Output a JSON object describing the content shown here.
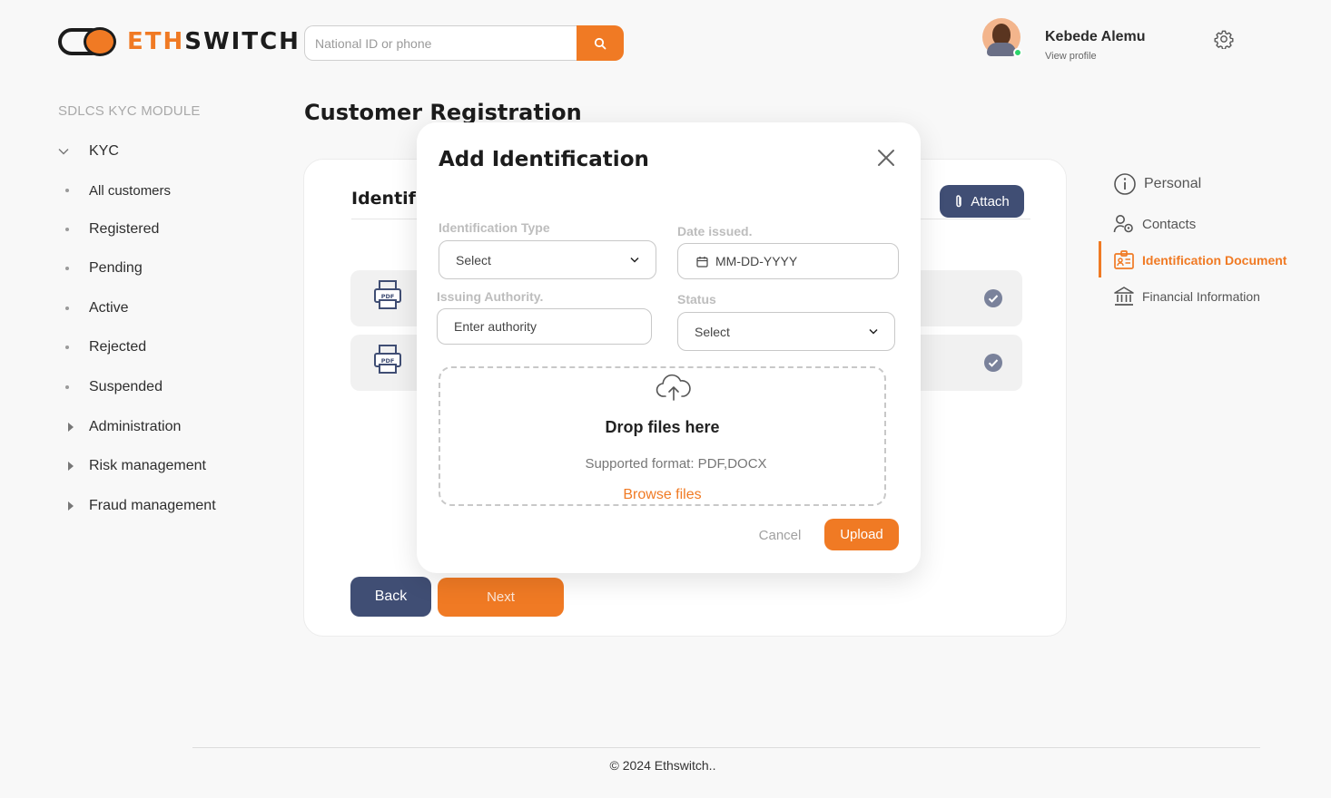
{
  "brand": {
    "prefix": "ETH",
    "suffix": "SWITCH",
    "accent_color": "#f07a24",
    "navy_color": "#404e74"
  },
  "search": {
    "placeholder": "National ID or phone",
    "icon": "search-icon"
  },
  "user": {
    "name": "Kebede Alemu",
    "profile_link": "View profile",
    "status": "online"
  },
  "sidebar": {
    "module_title": "SDLCS  KYC MODULE",
    "items": [
      {
        "label": "KYC",
        "marker": "chevron-down-icon"
      },
      {
        "label": "All customers",
        "marker": "bullet"
      },
      {
        "label": "Registered",
        "marker": "bullet"
      },
      {
        "label": "Pending",
        "marker": "bullet"
      },
      {
        "label": "Active",
        "marker": "bullet"
      },
      {
        "label": "Rejected",
        "marker": "bullet"
      },
      {
        "label": "Suspended",
        "marker": "bullet"
      },
      {
        "label": "Administration",
        "marker": "caret-right-icon"
      },
      {
        "label": "Risk management",
        "marker": "caret-right-icon"
      },
      {
        "label": "Fraud management",
        "marker": "caret-right-icon"
      }
    ]
  },
  "page": {
    "title": "Customer Registration"
  },
  "card": {
    "heading": "Identif",
    "attach_label": "Attach",
    "back_label": "Back",
    "next_label": "Next"
  },
  "steps": [
    {
      "label": "Personal",
      "icon": "info-circle-icon",
      "active": false
    },
    {
      "label": "Contacts",
      "icon": "contacts-icon",
      "active": false
    },
    {
      "label": "Identification Document",
      "icon": "id-card-icon",
      "active": true
    },
    {
      "label": "Financial Information",
      "icon": "bank-icon",
      "active": false
    }
  ],
  "modal": {
    "title": "Add Identification",
    "identification_type": {
      "label": "Identification Type",
      "value": "Select"
    },
    "date_issued": {
      "label": "Date issued.",
      "placeholder": "MM-DD-YYYY"
    },
    "issuing_authority": {
      "label": "Issuing Authority.",
      "placeholder": "Enter authority"
    },
    "status": {
      "label": "Status",
      "value": "Select"
    },
    "dropzone": {
      "title": "Drop files here",
      "subtitle": "Supported format: PDF,DOCX",
      "link": "Browse files"
    },
    "cancel_label": "Cancel",
    "upload_label": "Upload"
  },
  "footer": {
    "text": "© 2024  Ethswitch.."
  }
}
